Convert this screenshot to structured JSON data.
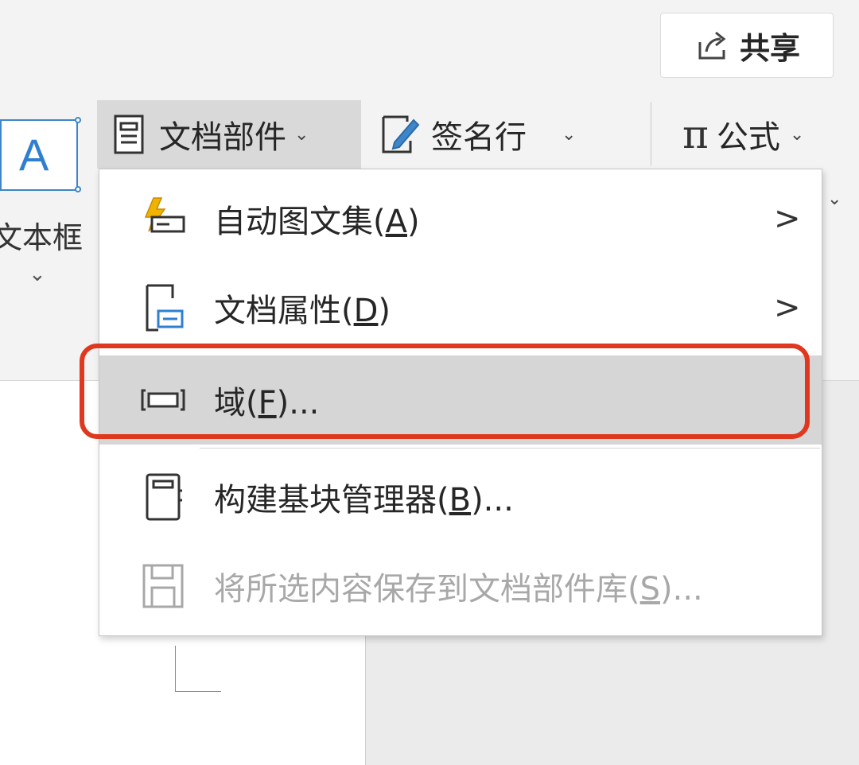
{
  "header": {
    "share_label": "共享",
    "share_icon": "share-icon"
  },
  "ribbon": {
    "textbox": {
      "letter": "A",
      "label": "文本框",
      "icon": "textbox-icon"
    },
    "doc_parts": {
      "label": "文档部件",
      "icon": "document-parts-icon"
    },
    "signature_line": {
      "label": "签名行",
      "icon": "signature-line-icon"
    },
    "formula": {
      "glyph": "π",
      "label": "公式"
    }
  },
  "menu": {
    "items": [
      {
        "label": "自动图文集",
        "mnemonic": "A",
        "icon": "autotext-icon",
        "submenu": true,
        "state": "normal"
      },
      {
        "label": "文档属性",
        "mnemonic": "D",
        "icon": "document-property-icon",
        "submenu": true,
        "state": "normal"
      },
      {
        "label": "域",
        "mnemonic": "F",
        "suffix": "...",
        "icon": "field-icon",
        "submenu": false,
        "state": "selected"
      },
      {
        "label": "构建基块管理器",
        "mnemonic": "B",
        "suffix": "...",
        "icon": "building-blocks-icon",
        "submenu": false,
        "state": "normal"
      },
      {
        "label": "将所选内容保存到文档部件库",
        "mnemonic": "S",
        "suffix": "...",
        "icon": "save-icon",
        "submenu": false,
        "state": "disabled"
      }
    ],
    "submenu_glyph": ">"
  },
  "colors": {
    "highlight_border": "#e0381e",
    "accent_blue": "#2f7fd0",
    "selected_bg": "#d6d6d6",
    "disabled_text": "#a8a8a8"
  }
}
